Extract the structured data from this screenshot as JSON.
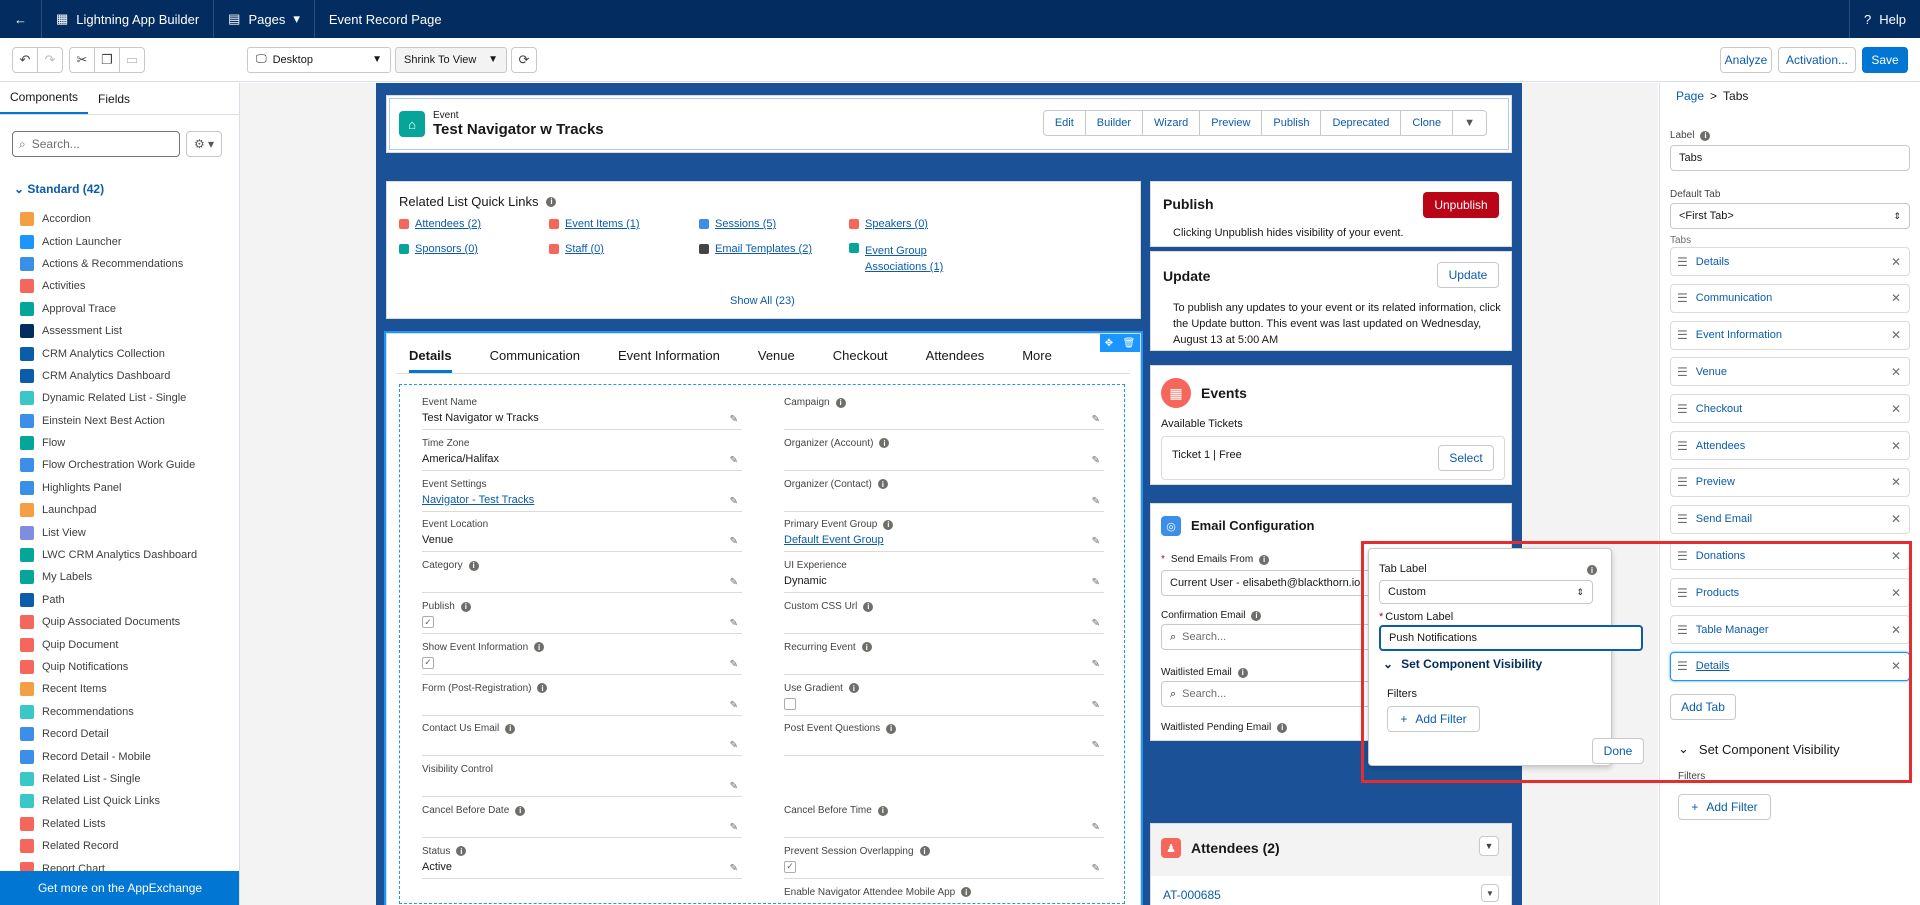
{
  "topbar": {
    "app": "Lightning App Builder",
    "pages": "Pages",
    "page_title": "Event Record Page",
    "help": "Help"
  },
  "toolbar": {
    "device": "Desktop",
    "view": "Shrink To View",
    "analyze": "Analyze",
    "activation": "Activation...",
    "save": "Save"
  },
  "left": {
    "tab_components": "Components",
    "tab_fields": "Fields",
    "search_placeholder": "Search...",
    "standard_header": "Standard (42)",
    "items": [
      {
        "label": "Accordion",
        "color": "#f59f45"
      },
      {
        "label": "Action Launcher",
        "color": "#1b96ff"
      },
      {
        "label": "Actions & Recommendations",
        "color": "#3b8fe8"
      },
      {
        "label": "Activities",
        "color": "#f5675b"
      },
      {
        "label": "Approval Trace",
        "color": "#06a59a"
      },
      {
        "label": "Assessment List",
        "color": "#032d60"
      },
      {
        "label": "CRM Analytics Collection",
        "color": "#0b5cab"
      },
      {
        "label": "CRM Analytics Dashboard",
        "color": "#0b5cab"
      },
      {
        "label": "Dynamic Related List - Single",
        "color": "#3ac7c8"
      },
      {
        "label": "Einstein Next Best Action",
        "color": "#3b8fe8"
      },
      {
        "label": "Flow",
        "color": "#06a59a"
      },
      {
        "label": "Flow Orchestration Work Guide",
        "color": "#3b8fe8"
      },
      {
        "label": "Highlights Panel",
        "color": "#3b8fe8"
      },
      {
        "label": "Launchpad",
        "color": "#f59f45"
      },
      {
        "label": "List View",
        "color": "#7f8de1"
      },
      {
        "label": "LWC CRM Analytics Dashboard",
        "color": "#06a59a"
      },
      {
        "label": "My Labels",
        "color": "#06a59a"
      },
      {
        "label": "Path",
        "color": "#0b5cab"
      },
      {
        "label": "Quip Associated Documents",
        "color": "#f5675b"
      },
      {
        "label": "Quip Document",
        "color": "#f5675b"
      },
      {
        "label": "Quip Notifications",
        "color": "#f5675b"
      },
      {
        "label": "Recent Items",
        "color": "#f59f45"
      },
      {
        "label": "Recommendations",
        "color": "#3ac7c8"
      },
      {
        "label": "Record Detail",
        "color": "#3b8fe8"
      },
      {
        "label": "Record Detail - Mobile",
        "color": "#3b8fe8"
      },
      {
        "label": "Related List - Single",
        "color": "#3ac7c8"
      },
      {
        "label": "Related List Quick Links",
        "color": "#3ac7c8"
      },
      {
        "label": "Related Lists",
        "color": "#f5675b"
      },
      {
        "label": "Related Record",
        "color": "#f5675b"
      },
      {
        "label": "Report Chart",
        "color": "#f5675b"
      }
    ],
    "appexchange": "Get more on the AppExchange"
  },
  "header": {
    "object": "Event",
    "name": "Test Navigator w Tracks",
    "buttons": [
      "Edit",
      "Builder",
      "Wizard",
      "Preview",
      "Publish",
      "Deprecated",
      "Clone"
    ]
  },
  "quicklinks": {
    "title": "Related List Quick Links",
    "links": [
      {
        "label": "Attendees (2)",
        "color": "#f5675b"
      },
      {
        "label": "Event Items (1)",
        "color": "#f5675b"
      },
      {
        "label": "Sessions (5)",
        "color": "#3b8fe8"
      },
      {
        "label": "Speakers (0)",
        "color": "#f5675b"
      },
      {
        "label": "Sponsors (0)",
        "color": "#06a59a"
      },
      {
        "label": "Staff (0)",
        "color": "#f5675b"
      },
      {
        "label": "Email Templates (2)",
        "color": "#444"
      },
      {
        "label": "Event Group",
        "label2": "Associations (1)",
        "color": "#06a59a"
      }
    ],
    "show_all": "Show All (23)"
  },
  "tabs": [
    "Details",
    "Communication",
    "Event Information",
    "Venue",
    "Checkout",
    "Attendees",
    "More"
  ],
  "fields": [
    {
      "label": "Event Name",
      "value": "Test Navigator w Tracks"
    },
    {
      "label": "Campaign",
      "value": ""
    },
    {
      "label": "Time Zone",
      "value": "America/Halifax"
    },
    {
      "label": "Organizer (Account)",
      "value": ""
    },
    {
      "label": "Event Settings",
      "value": "Navigator - Test Tracks"
    },
    {
      "label": "Organizer (Contact)",
      "value": ""
    },
    {
      "label": "Event Location",
      "value": "Venue"
    },
    {
      "label": "Primary Event Group",
      "value": "Default Event Group"
    },
    {
      "label": "Category",
      "value": ""
    },
    {
      "label": "UI Experience",
      "value": "Dynamic"
    },
    {
      "label": "Publish",
      "value": ""
    },
    {
      "label": "Custom CSS Url",
      "value": ""
    },
    {
      "label": "Show Event Information",
      "value": ""
    },
    {
      "label": "Recurring Event",
      "value": ""
    },
    {
      "label": "Form (Post-Registration)",
      "value": ""
    },
    {
      "label": "Use Gradient",
      "value": ""
    },
    {
      "label": "Contact Us Email",
      "value": ""
    },
    {
      "label": "Post Event Questions",
      "value": ""
    },
    {
      "label": "Visibility Control",
      "value": ""
    },
    {
      "label": "",
      "value": ""
    },
    {
      "label": "Cancel Before Date",
      "value": ""
    },
    {
      "label": "Cancel Before Time",
      "value": ""
    },
    {
      "label": "Status",
      "value": "Active"
    },
    {
      "label": "Prevent Session Overlapping",
      "value": ""
    },
    {
      "label": "",
      "value": ""
    },
    {
      "label": "Enable Navigator Attendee Mobile App",
      "value": ""
    }
  ],
  "publish": {
    "title": "Publish",
    "button": "Unpublish",
    "text": "Clicking Unpublish hides visibility of your event."
  },
  "update": {
    "title": "Update",
    "button": "Update",
    "text": "To publish any updates to your event or its related information, click the Update button. This event was last updated on Wednesday, August 13 at 5:00 AM"
  },
  "events": {
    "title": "Events",
    "available": "Available Tickets",
    "ticket": "Ticket 1 | Free",
    "select": "Select"
  },
  "email": {
    "title": "Email Configuration",
    "send_from_label": "Send Emails From",
    "send_from": "Current User - elisabeth@blackthorn.io",
    "confirmation": "Confirmation Email",
    "waitlisted": "Waitlisted Email",
    "waitlisted_pending": "Waitlisted Pending Email",
    "search_placeholder": "Search..."
  },
  "attendees": {
    "title": "Attendees (2)",
    "first": "AT-000685"
  },
  "props": {
    "breadcrumb_page": "Page",
    "breadcrumb_sep": ">",
    "breadcrumb_current": "Tabs",
    "label_label": "Label",
    "label_value": "Tabs",
    "default_tab_label": "Default Tab",
    "default_tab": "<First Tab>",
    "tabs_label": "Tabs",
    "tab_items": [
      "Details",
      "Communication",
      "Event Information",
      "Venue",
      "Checkout",
      "Attendees",
      "Preview",
      "Send Email",
      "Donations",
      "Products",
      "Table Manager",
      "Details"
    ],
    "add_tab": "Add Tab",
    "visibility": "Set Component Visibility",
    "filters": "Filters",
    "add_filter": "Add Filter"
  },
  "popup": {
    "tab_label": "Tab Label",
    "tab_label_value": "Custom",
    "custom_label": "Custom Label",
    "custom_value": "Push Notifications",
    "visibility": "Set Component Visibility",
    "filters": "Filters",
    "add_filter": "Add Filter",
    "done": "Done"
  }
}
